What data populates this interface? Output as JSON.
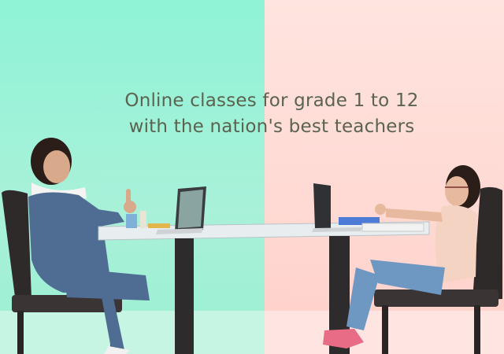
{
  "hero": {
    "headline_line1": "Online classes for grade 1 to 12",
    "headline_line2": "with the nation's best teachers",
    "colors": {
      "left_background": "#9ff1d6",
      "right_background": "#ffdcd6",
      "headline_text": "#5b6350"
    }
  }
}
